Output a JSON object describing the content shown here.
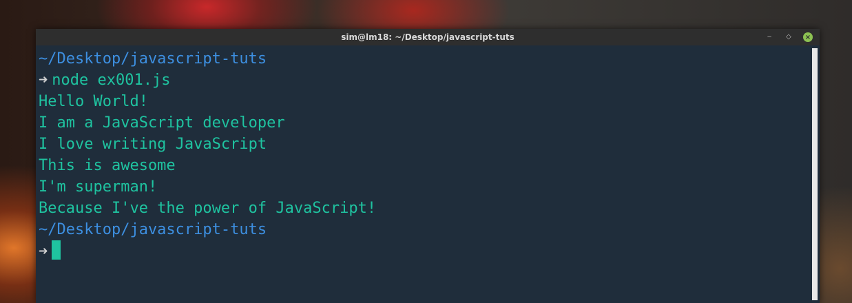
{
  "window": {
    "title": "sim@lm18: ~/Desktop/javascript-tuts",
    "controls": {
      "minimize": "‒",
      "maximize": "◇",
      "close": "×"
    }
  },
  "terminal": {
    "prompt_symbol": "➜",
    "lines": {
      "path1": "~/Desktop/javascript-tuts",
      "command1": "node ex001.js",
      "out1": "Hello World!",
      "out2": "I am a JavaScript developer",
      "out3": "I love writing JavaScript",
      "out4": "This is awesome",
      "out5": "I'm superman!",
      "out6": "Because I've the power of JavaScript!",
      "path2": "~/Desktop/javascript-tuts"
    }
  },
  "colors": {
    "background": "#1f2d3b",
    "path": "#3d8fe0",
    "output": "#1fc3a0",
    "close_button": "#8cc152"
  }
}
